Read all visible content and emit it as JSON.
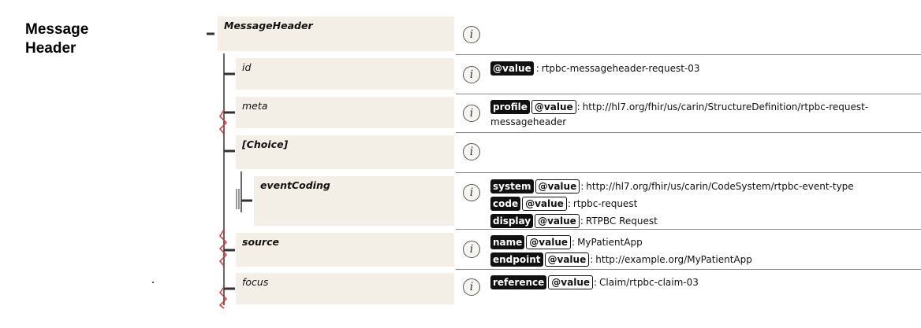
{
  "section": {
    "title": "Message Header"
  },
  "elements": {
    "message_header": "MessageHeader",
    "id": "id",
    "meta": "meta",
    "choice": "[Choice]",
    "event_coding": "eventCoding",
    "source": "source",
    "focus": "focus"
  },
  "info_icon": {
    "glyph": "i",
    "name": "info-icon"
  },
  "tags": {
    "value": "@value",
    "profile": "profile",
    "system": "system",
    "code": "code",
    "display": "display",
    "name": "name",
    "endpoint": "endpoint",
    "reference": "reference"
  },
  "separator": ":",
  "values": {
    "id": "rtpbc-messageheader-request-03",
    "meta_profile_line1": "http://hl7.org/fhir/us/carin/StructureDefinition/rtpbc-request-",
    "meta_profile_line2": "messageheader",
    "event_system": "http://hl7.org/fhir/us/carin/CodeSystem/rtpbc-event-type",
    "event_code": "rtpbc-request",
    "event_display": "RTPBC Request",
    "source_name": "MyPatientApp",
    "source_endpoint": "http://example.org/MyPatientApp",
    "focus_reference": "Claim/rtpbc-claim-03"
  },
  "colors": {
    "box_fill": "#f4efe6",
    "tree_line": "#333333",
    "cardinality_zigzag": "#e03030",
    "tag_dark": "#111111"
  }
}
